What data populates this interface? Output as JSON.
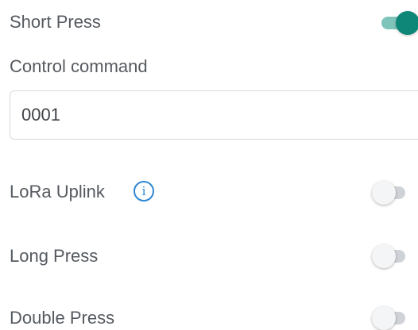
{
  "short_press": {
    "label": "Short Press",
    "enabled": true
  },
  "control_command": {
    "label": "Control command",
    "value": "0001"
  },
  "lora_uplink": {
    "label": "LoRa Uplink",
    "info_icon": "info-icon",
    "enabled": false
  },
  "long_press": {
    "label": "Long Press",
    "enabled": false
  },
  "double_press": {
    "label": "Double Press",
    "enabled": false
  },
  "colors": {
    "toggle_on_knob": "#0e8678",
    "toggle_on_track": "#7fc4bb",
    "toggle_off_track": "#cfd2d6",
    "info_icon": "#2f87d4"
  }
}
